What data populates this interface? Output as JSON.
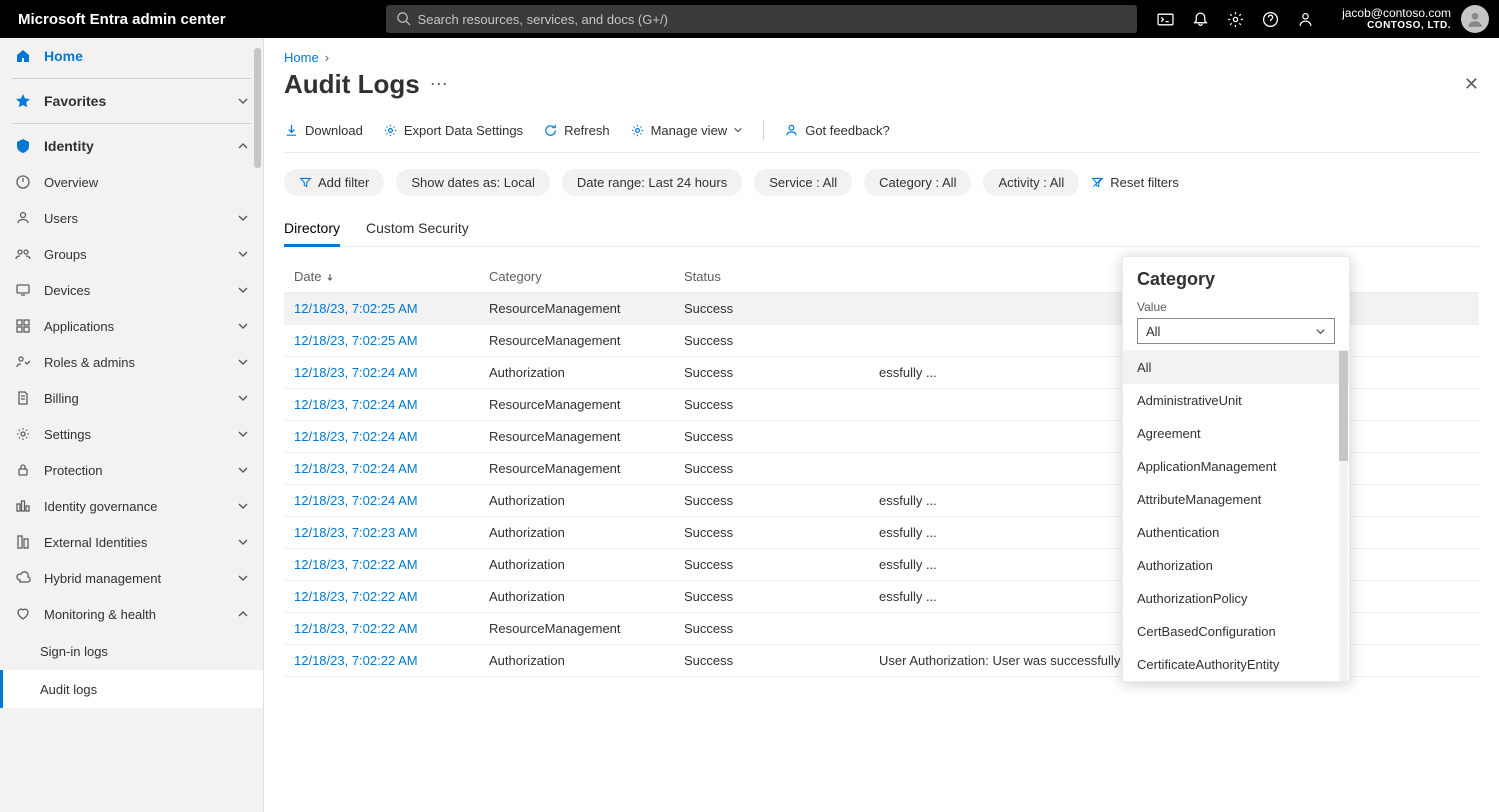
{
  "brand": "Microsoft Entra admin center",
  "search": {
    "placeholder": "Search resources, services, and docs (G+/)"
  },
  "user": {
    "email": "jacob@contoso.com",
    "org": "CONTOSO, LTD."
  },
  "breadcrumb": {
    "home": "Home"
  },
  "page_title": "Audit Logs",
  "toolbar": {
    "download": "Download",
    "export": "Export Data Settings",
    "refresh": "Refresh",
    "manage": "Manage view",
    "feedback": "Got feedback?"
  },
  "filters": {
    "add": "Add filter",
    "dates": "Show dates as: Local",
    "range": "Date range: Last 24 hours",
    "service": "Service : All",
    "category": "Category : All",
    "activity": "Activity : All",
    "reset": "Reset filters"
  },
  "tabs": {
    "directory": "Directory",
    "custom": "Custom Security"
  },
  "table": {
    "headers": {
      "date": "Date",
      "category": "Category",
      "status": "Status"
    },
    "rows": [
      {
        "date": "12/18/23, 7:02:25 AM",
        "category": "ResourceManagement",
        "status": "Success",
        "msg": ""
      },
      {
        "date": "12/18/23, 7:02:25 AM",
        "category": "ResourceManagement",
        "status": "Success",
        "msg": ""
      },
      {
        "date": "12/18/23, 7:02:24 AM",
        "category": "Authorization",
        "status": "Success",
        "msg": "essfully ..."
      },
      {
        "date": "12/18/23, 7:02:24 AM",
        "category": "ResourceManagement",
        "status": "Success",
        "msg": ""
      },
      {
        "date": "12/18/23, 7:02:24 AM",
        "category": "ResourceManagement",
        "status": "Success",
        "msg": ""
      },
      {
        "date": "12/18/23, 7:02:24 AM",
        "category": "ResourceManagement",
        "status": "Success",
        "msg": ""
      },
      {
        "date": "12/18/23, 7:02:24 AM",
        "category": "Authorization",
        "status": "Success",
        "msg": "essfully ..."
      },
      {
        "date": "12/18/23, 7:02:23 AM",
        "category": "Authorization",
        "status": "Success",
        "msg": "essfully ..."
      },
      {
        "date": "12/18/23, 7:02:22 AM",
        "category": "Authorization",
        "status": "Success",
        "msg": "essfully ..."
      },
      {
        "date": "12/18/23, 7:02:22 AM",
        "category": "Authorization",
        "status": "Success",
        "msg": "essfully ..."
      },
      {
        "date": "12/18/23, 7:02:22 AM",
        "category": "ResourceManagement",
        "status": "Success",
        "msg": ""
      },
      {
        "date": "12/18/23, 7:02:22 AM",
        "category": "Authorization",
        "status": "Success",
        "msg": "User Authorization: User was successfully ..."
      }
    ]
  },
  "popup": {
    "title": "Category",
    "value_label": "Value",
    "selected": "All",
    "options": [
      "All",
      "AdministrativeUnit",
      "Agreement",
      "ApplicationManagement",
      "AttributeManagement",
      "Authentication",
      "Authorization",
      "AuthorizationPolicy",
      "CertBasedConfiguration",
      "CertificateAuthorityEntity"
    ]
  },
  "sidebar": {
    "home": "Home",
    "favorites": "Favorites",
    "identity": "Identity",
    "items": [
      "Overview",
      "Users",
      "Groups",
      "Devices",
      "Applications",
      "Roles & admins",
      "Billing",
      "Settings",
      "Protection",
      "Identity governance",
      "External Identities",
      "Hybrid management",
      "Monitoring & health"
    ],
    "subs": {
      "signin": "Sign-in logs",
      "audit": "Audit logs"
    }
  }
}
